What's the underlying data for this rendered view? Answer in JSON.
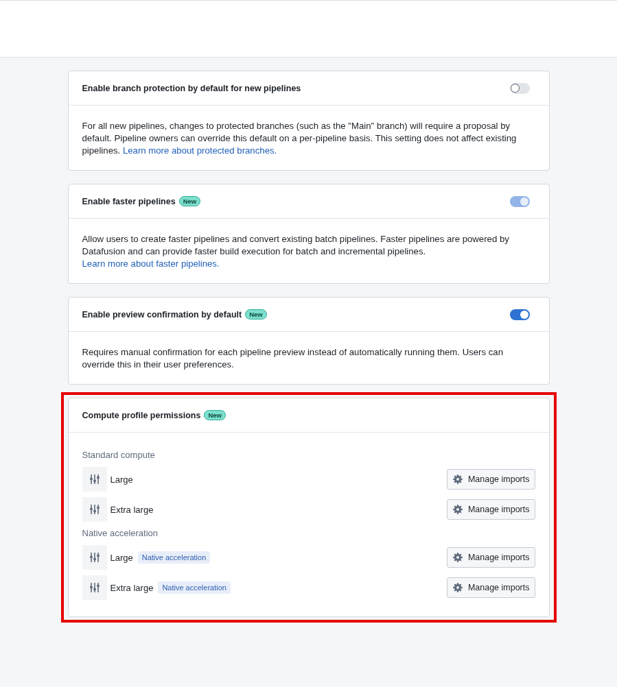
{
  "settings": [
    {
      "title": "Enable branch protection by default for new pipelines",
      "on": false,
      "disabled": false,
      "description": "For all new pipelines, changes to protected branches (such as the \"Main\" branch) will require a proposal by default. Pipeline owners can override this default on a per-pipeline basis. This setting does not affect existing pipelines.",
      "link": "Learn more about protected branches."
    },
    {
      "title": "Enable faster pipelines",
      "badge": "New",
      "on": true,
      "disabled": true,
      "description": "Allow users to create faster pipelines and convert existing batch pipelines. Faster pipelines are powered by Datafusion and can provide faster build execution for batch and incremental pipelines.",
      "link": "Learn more about faster pipelines."
    },
    {
      "title": "Enable preview confirmation by default",
      "badge": "New",
      "on": true,
      "disabled": false,
      "description": "Requires manual confirmation for each pipeline preview instead of automatically running them. Users can override this in their user preferences."
    }
  ],
  "compute_profiles": {
    "title": "Compute profile permissions",
    "badge": "New",
    "highlighted": true,
    "groups": [
      {
        "label": "Standard compute",
        "profiles": [
          {
            "name": "Large",
            "button": "Manage imports"
          },
          {
            "name": "Extra large",
            "button": "Manage imports"
          }
        ]
      },
      {
        "label": "Native acceleration",
        "profiles": [
          {
            "name": "Large",
            "tag": "Native acceleration",
            "button": "Manage imports"
          },
          {
            "name": "Extra large",
            "tag": "Native acceleration",
            "button": "Manage imports"
          }
        ]
      }
    ]
  }
}
